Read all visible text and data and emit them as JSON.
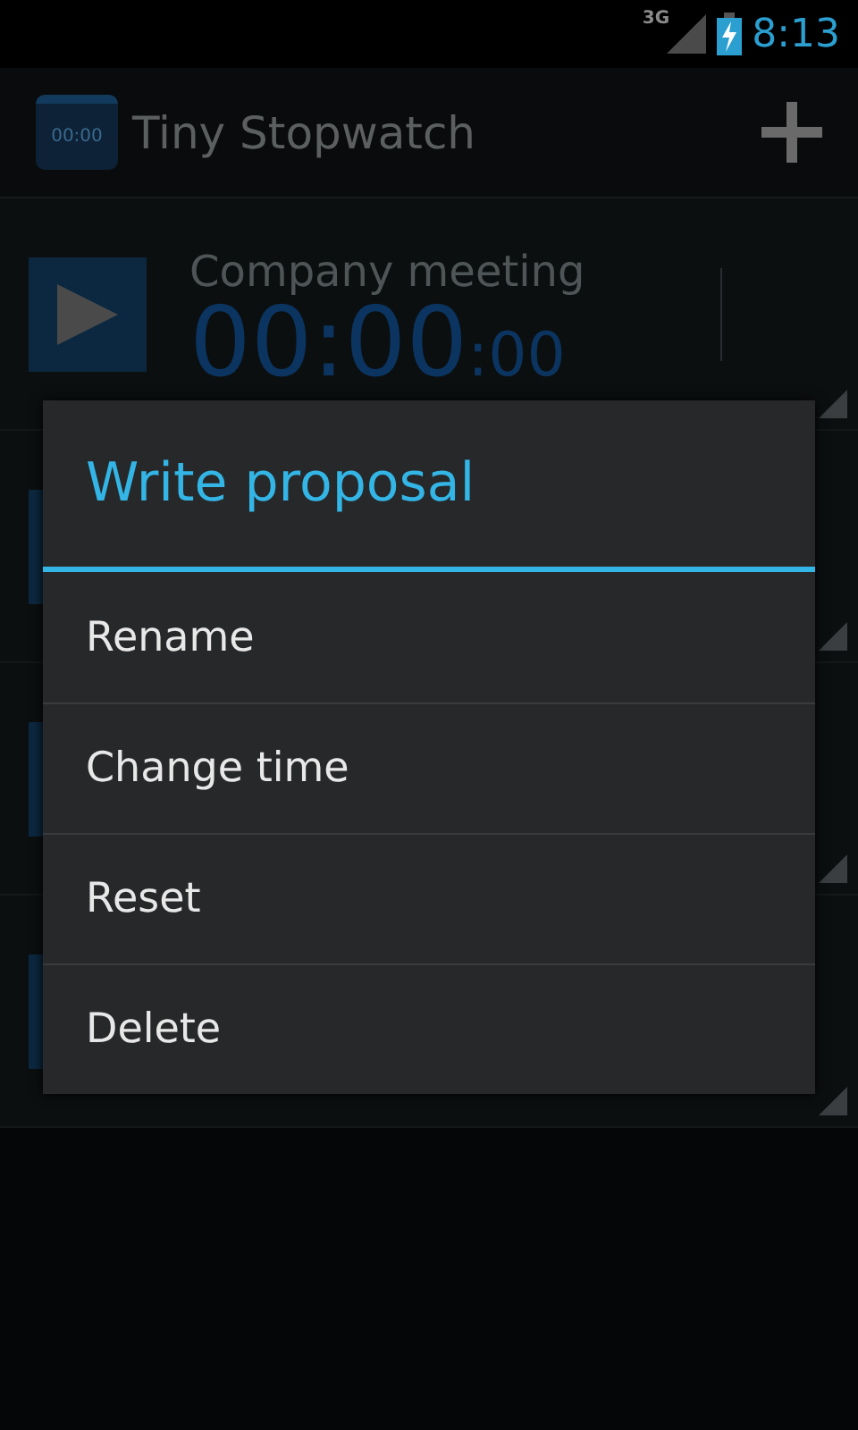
{
  "status_bar": {
    "network": "3G",
    "time": "8:13"
  },
  "action_bar": {
    "title": "Tiny Stopwatch",
    "icon_text": "00:00"
  },
  "stopwatches": [
    {
      "name": "Company meeting",
      "time": "00:00",
      "fraction": ":00",
      "running": false
    },
    {
      "running": false
    },
    {
      "running": false
    },
    {
      "running": false
    }
  ],
  "dialog": {
    "title": "Write proposal",
    "items": [
      "Rename",
      "Change time",
      "Reset",
      "Delete"
    ]
  }
}
